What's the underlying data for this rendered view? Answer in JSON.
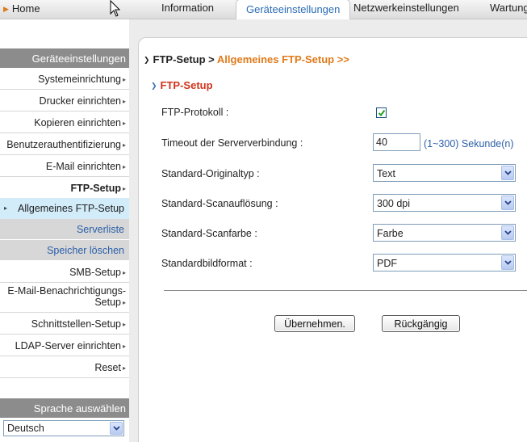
{
  "topnav": {
    "home": "Home",
    "tabs": [
      {
        "label": "Information"
      },
      {
        "label": "Geräteeinstellungen"
      },
      {
        "label": "Netzwerkeinstellungen"
      },
      {
        "label": "Wartung"
      }
    ],
    "active_tab": "Geräteeinstellungen"
  },
  "sidebar": {
    "header": "Geräteeinstellungen",
    "items": [
      {
        "label": "Systemeinrichtung"
      },
      {
        "label": "Drucker einrichten"
      },
      {
        "label": "Kopieren einrichten"
      },
      {
        "label": "Benutzerauthentifizierung"
      },
      {
        "label": "E-Mail einrichten"
      },
      {
        "label": "FTP-Setup"
      }
    ],
    "subitems": [
      {
        "label": "Allgemeines FTP-Setup"
      },
      {
        "label": "Serverliste"
      },
      {
        "label": "Speicher löschen"
      }
    ],
    "items_after": [
      {
        "label": "SMB-Setup"
      },
      {
        "label_line1": "E-Mail-Benachrichtigungs-",
        "label_line2": "Setup"
      },
      {
        "label": "Schnittstellen-Setup"
      },
      {
        "label": "LDAP-Server einrichten"
      },
      {
        "label": "Reset"
      }
    ],
    "language_header": "Sprache auswählen",
    "language_value": "Deutsch"
  },
  "breadcrumb": {
    "parent": "FTP-Setup",
    "separator": ">",
    "current": "Allgemeines FTP-Setup >>"
  },
  "section_title": "FTP-Setup",
  "form": {
    "ftp_protocol": {
      "label": "FTP-Protokoll :",
      "checked": true
    },
    "timeout": {
      "label": "Timeout der Serververbindung :",
      "value": "40",
      "hint": "(1~300) Sekunde(n)"
    },
    "original_type": {
      "label": "Standard-Originaltyp :",
      "value": "Text"
    },
    "scan_resolution": {
      "label": "Standard-Scanauflösung :",
      "value": "300 dpi"
    },
    "scan_color": {
      "label": "Standard-Scanfarbe :",
      "value": "Farbe"
    },
    "image_format": {
      "label": "Standardbildformat :",
      "value": "PDF"
    }
  },
  "buttons": {
    "apply": "Übernehmen.",
    "undo": "Rückgängig"
  },
  "colors": {
    "accent_orange": "#e07a1a",
    "section_red": "#d0331b",
    "link_blue": "#2a5fa8",
    "sidebar_header": "#8c8c8c",
    "current_sub_bg": "#d3ecfa"
  }
}
